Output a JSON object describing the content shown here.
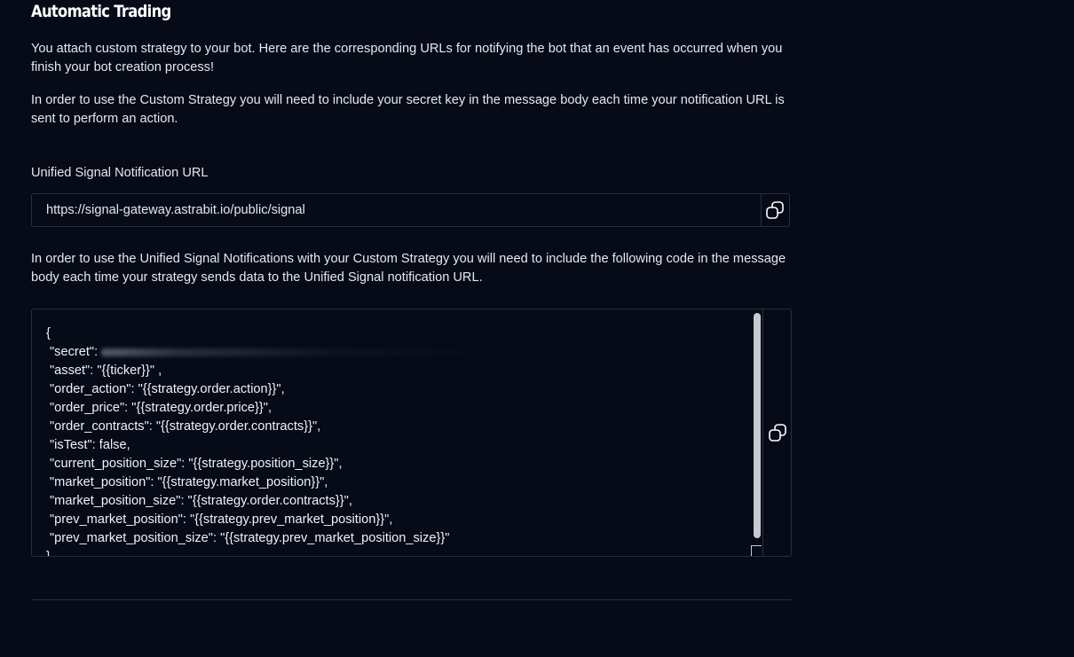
{
  "page": {
    "title": "Automatic Trading",
    "intro_paragraph": "You attach custom strategy to your bot. Here are the corresponding URLs for notifying the bot that an event has occurred when you finish your bot creation process!",
    "secret_paragraph": "In order to use the Custom Strategy you will need to include your secret key in the message body each time your notification URL is sent to perform an action."
  },
  "signal_url": {
    "label": "Unified Signal Notification URL",
    "value": "https://signal-gateway.astrabit.io/public/signal",
    "copy_icon": "copy-icon"
  },
  "signal_code": {
    "instructions": "In order to use the Unified Signal Notifications with your Custom Strategy you will need to include the following code in the message body each time your strategy sends data to the Unified Signal notification URL.",
    "lines": [
      "{",
      "\"secret\":",
      "\"asset\": \"{{ticker}}\" ,",
      "\"order_action\": \"{{strategy.order.action}}\",",
      "\"order_price\": \"{{strategy.order.price}}\",",
      "\"order_contracts\": \"{{strategy.order.contracts}}\",",
      "\"isTest\": false,",
      "\"current_position_size\": \"{{strategy.position_size}}\",",
      "\"market_position\": \"{{strategy.market_position}}\",",
      "\"market_position_size\": \"{{strategy.order.contracts}}\",",
      "\"prev_market_position\": \"{{strategy.prev_market_position}}\",",
      "\"prev_market_position_size\": \"{{strategy.prev_market_position_size}}\"",
      "}"
    ],
    "copy_icon": "copy-icon"
  },
  "colors": {
    "background": "#060b17",
    "border": "#2a2f3d",
    "text": "#e6e8ee",
    "title": "#ffffff"
  }
}
